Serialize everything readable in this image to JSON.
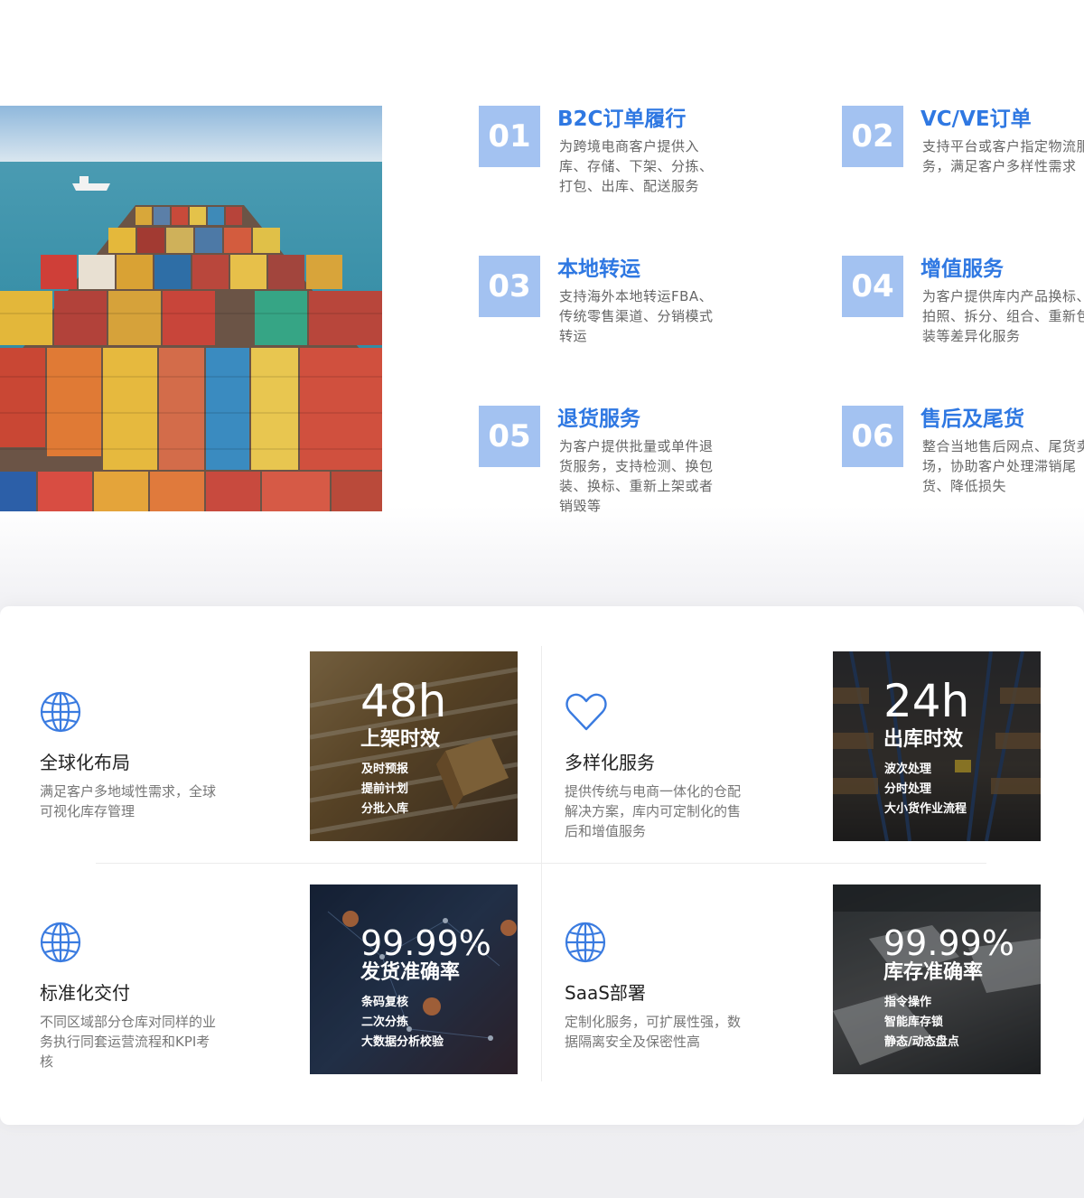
{
  "services": [
    {
      "num": "01",
      "title": "B2C订单履行",
      "desc": "为跨境电商客户提供入库、存储、下架、分拣、打包、出库、配送服务"
    },
    {
      "num": "02",
      "title": "VC/VE订单",
      "desc": "支持平台或客户指定物流服务，满足客户多样性需求"
    },
    {
      "num": "03",
      "title": "本地转运",
      "desc": "支持海外本地转运FBA、传统零售渠道、分销模式转运"
    },
    {
      "num": "04",
      "title": "增值服务",
      "desc": "为客户提供库内产品换标、拍照、拆分、组合、重新包装等差异化服务"
    },
    {
      "num": "05",
      "title": "退货服务",
      "desc": "为客户提供批量或单件退货服务，支持检测、换包装、换标、重新上架或者销毁等"
    },
    {
      "num": "06",
      "title": "售后及尾货",
      "desc": "整合当地售后网点、尾货卖场，协助客户处理滞销尾货、降低损失"
    }
  ],
  "features": [
    {
      "title": "全球化布局",
      "desc": "满足客户多地域性需求，全球可视化库存管理",
      "icon": "globe-icon"
    },
    {
      "title": "多样化服务",
      "desc": "提供传统与电商一体化的仓配解决方案，库内可定制化的售后和增值服务",
      "icon": "heart-icon"
    },
    {
      "title": "标准化交付",
      "desc": "不同区域部分仓库对同样的业务执行同套运营流程和KPI考核",
      "icon": "globe-icon"
    },
    {
      "title": "SaaS部署",
      "desc": "定制化服务，可扩展性强，数据隔离安全及保密性高",
      "icon": "globe-icon"
    }
  ],
  "stats": [
    {
      "value": "48h",
      "label": "上架时效",
      "items": [
        "及时预报",
        "提前计划",
        "分批入库"
      ]
    },
    {
      "value": "24h",
      "label": "出库时效",
      "items": [
        "波次处理",
        "分时处理",
        "大小货作业流程"
      ]
    },
    {
      "value": "99.99%",
      "label": "发货准确率",
      "items": [
        "条码复核",
        "二次分拣",
        "大数据分析校验"
      ]
    },
    {
      "value": "99.99%",
      "label": "库存准确率",
      "items": [
        "指令操作",
        "智能库存锁",
        "静态/动态盘点"
      ]
    }
  ],
  "colors": {
    "accent": "#2f78e2",
    "num_bg": "#a3c2f1",
    "icon": "#3a7be0"
  }
}
